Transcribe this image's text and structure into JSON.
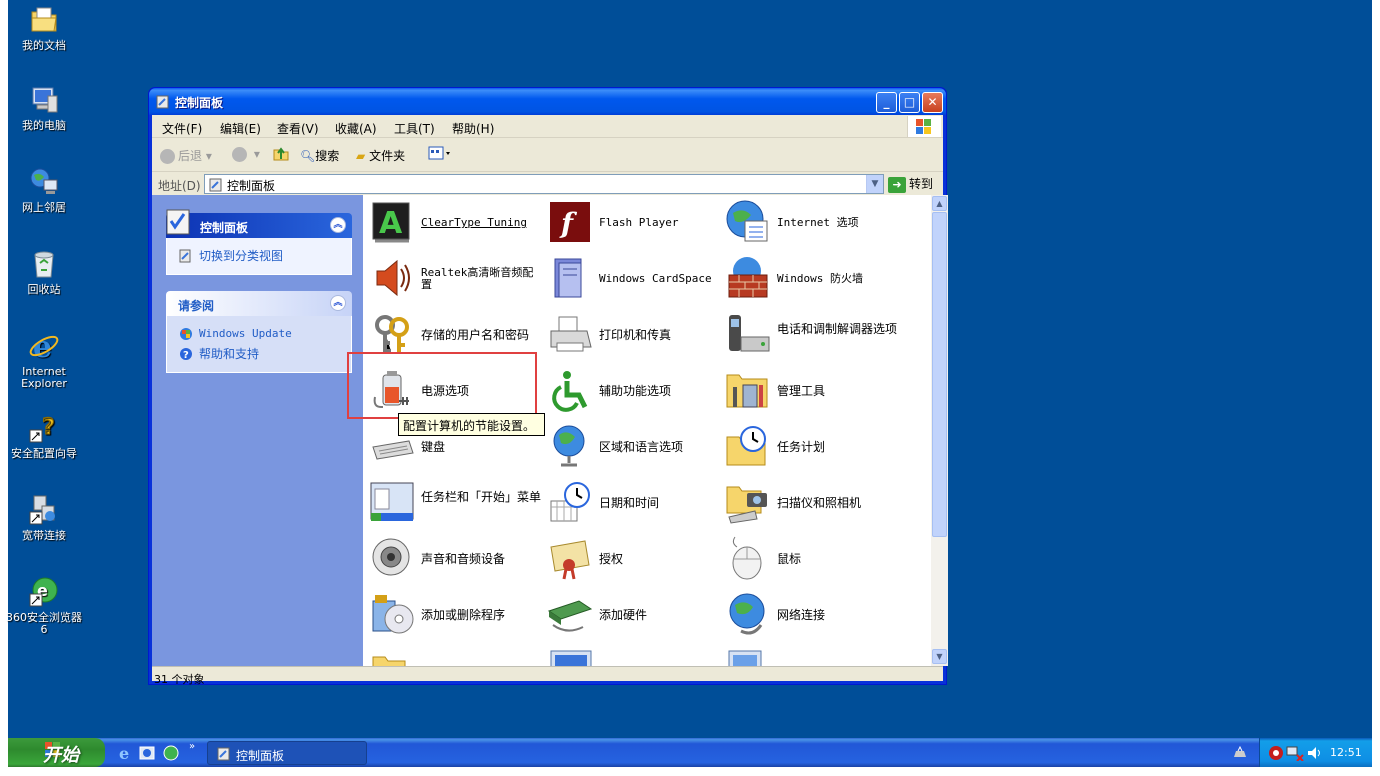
{
  "desktop": {
    "icons": [
      {
        "label": "我的文档",
        "icon": "my-documents-icon"
      },
      {
        "label": "我的电脑",
        "icon": "my-computer-icon"
      },
      {
        "label": "网上邻居",
        "icon": "network-places-icon"
      },
      {
        "label": "回收站",
        "icon": "recycle-bin-icon"
      },
      {
        "label": "Internet Explorer",
        "icon": "internet-explorer-icon"
      },
      {
        "label": "安全配置向导",
        "icon": "security-wizard-icon"
      },
      {
        "label": "宽带连接",
        "icon": "broadband-icon"
      },
      {
        "label": "360安全浏览器6",
        "icon": "360-browser-icon"
      }
    ]
  },
  "window": {
    "title": "控制面板",
    "menu": [
      "文件(F)",
      "编辑(E)",
      "查看(V)",
      "收藏(A)",
      "工具(T)",
      "帮助(H)"
    ],
    "toolbar": {
      "back": "后退",
      "search": "搜索",
      "folders": "文件夹"
    },
    "address": {
      "label": "地址(D)",
      "value": "控制面板",
      "go": "转到"
    },
    "taskpane": {
      "panel_title": "控制面板",
      "switch_view": "切换到分类视图",
      "see_also_title": "请参阅",
      "links": [
        "Windows Update",
        "帮助和支持"
      ]
    },
    "items": [
      {
        "label": "ClearType Tuning",
        "icon": "cleartype-icon"
      },
      {
        "label": "Flash Player",
        "icon": "flash-player-icon"
      },
      {
        "label": "Internet 选项",
        "icon": "internet-options-icon"
      },
      {
        "label": "Realtek高清晰音频配置",
        "icon": "realtek-audio-icon"
      },
      {
        "label": "Windows CardSpace",
        "icon": "cardspace-icon"
      },
      {
        "label": "Windows 防火墙",
        "icon": "firewall-icon"
      },
      {
        "label": "存储的用户名和密码",
        "icon": "stored-passwords-icon"
      },
      {
        "label": "打印机和传真",
        "icon": "printers-icon"
      },
      {
        "label": "电话和调制解调器选项",
        "icon": "phone-modem-icon"
      },
      {
        "label": "电源选项",
        "icon": "power-options-icon"
      },
      {
        "label": "辅助功能选项",
        "icon": "accessibility-icon"
      },
      {
        "label": "管理工具",
        "icon": "admin-tools-icon"
      },
      {
        "label": "键盘",
        "icon": "keyboard-icon"
      },
      {
        "label": "区域和语言选项",
        "icon": "regional-icon"
      },
      {
        "label": "任务计划",
        "icon": "scheduled-tasks-icon"
      },
      {
        "label": "任务栏和「开始」菜单",
        "icon": "taskbar-icon"
      },
      {
        "label": "日期和时间",
        "icon": "date-time-icon"
      },
      {
        "label": "扫描仪和照相机",
        "icon": "scanners-icon"
      },
      {
        "label": "声音和音频设备",
        "icon": "sounds-icon"
      },
      {
        "label": "授权",
        "icon": "licensing-icon"
      },
      {
        "label": "鼠标",
        "icon": "mouse-icon"
      },
      {
        "label": "添加或删除程序",
        "icon": "add-remove-icon"
      },
      {
        "label": "添加硬件",
        "icon": "add-hardware-icon"
      },
      {
        "label": "网络连接",
        "icon": "network-connections-icon"
      }
    ],
    "tooltip": "配置计算机的节能设置。",
    "status": "31 个对象"
  },
  "taskbar": {
    "start": "开始",
    "task_label": "控制面板",
    "clock": "12:51"
  },
  "colors": {
    "desktop": "#004e98",
    "highlight": "#e04040"
  }
}
